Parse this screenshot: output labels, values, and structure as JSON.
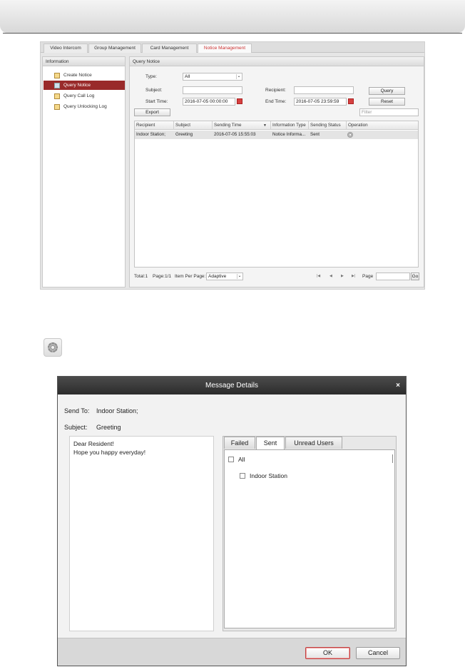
{
  "app": {
    "tabs": [
      "Video Intercom",
      "Group Management",
      "Card Management",
      "Notice Management"
    ],
    "active_tab": "Notice Management",
    "left_panel": {
      "title": "Information",
      "items": [
        "Create Notice",
        "Query Notice",
        "Query Call Log",
        "Query Unlocking Log"
      ],
      "active_item": "Query Notice"
    },
    "query": {
      "title": "Query Notice",
      "type_label": "Type:",
      "type_value": "All",
      "subject_label": "Subject:",
      "subject_value": "",
      "recipient_label": "Recipient:",
      "recipient_value": "",
      "start_label": "Start Time:",
      "start_value": "2016-07-05 00:00:00",
      "end_label": "End Time:",
      "end_value": "2016-07-05 23:59:59",
      "query_button": "Query",
      "reset_button": "Reset",
      "export_button": "Export",
      "filter_placeholder": "Filter"
    },
    "table": {
      "columns": [
        "Recipient",
        "Subject",
        "Sending Time",
        "Information Type",
        "Sending Status",
        "Operation"
      ],
      "rows": [
        {
          "recipient": "Indoor Station;",
          "subject": "Greeting",
          "sending_time": "2016-07-05 15:55:03",
          "information_type": "Notice Informa...",
          "sending_status": "Sent"
        }
      ]
    },
    "footer": {
      "total": "Total:1",
      "page": "Page:1/1",
      "item_per_page_label": "Item Per Page:",
      "item_per_page_value": "Adaptive",
      "page_label": "Page",
      "go_button": "Go"
    }
  },
  "dialog": {
    "title": "Message Details",
    "close_glyph": "×",
    "send_to_label": "Send To:",
    "send_to_value": "Indoor Station;",
    "subject_label": "Subject:",
    "subject_value": "Greeting",
    "message_lines": [
      "Dear Resident!",
      "Hope you happy everyday!"
    ],
    "tabs": [
      "Failed",
      "Sent",
      "Unread Users"
    ],
    "active_tab": "Sent",
    "all_label": "All",
    "recipients": [
      "Indoor Station"
    ],
    "ok_button": "OK",
    "cancel_button": "Cancel"
  },
  "icons": {
    "gear": "gear-icon",
    "calendar": "calendar-icon",
    "nav_item": "document-icon"
  },
  "colors": {
    "active_nav": "#992a2a",
    "active_tab_text": "#cc3333",
    "dialog_title_bar": "#333333"
  }
}
